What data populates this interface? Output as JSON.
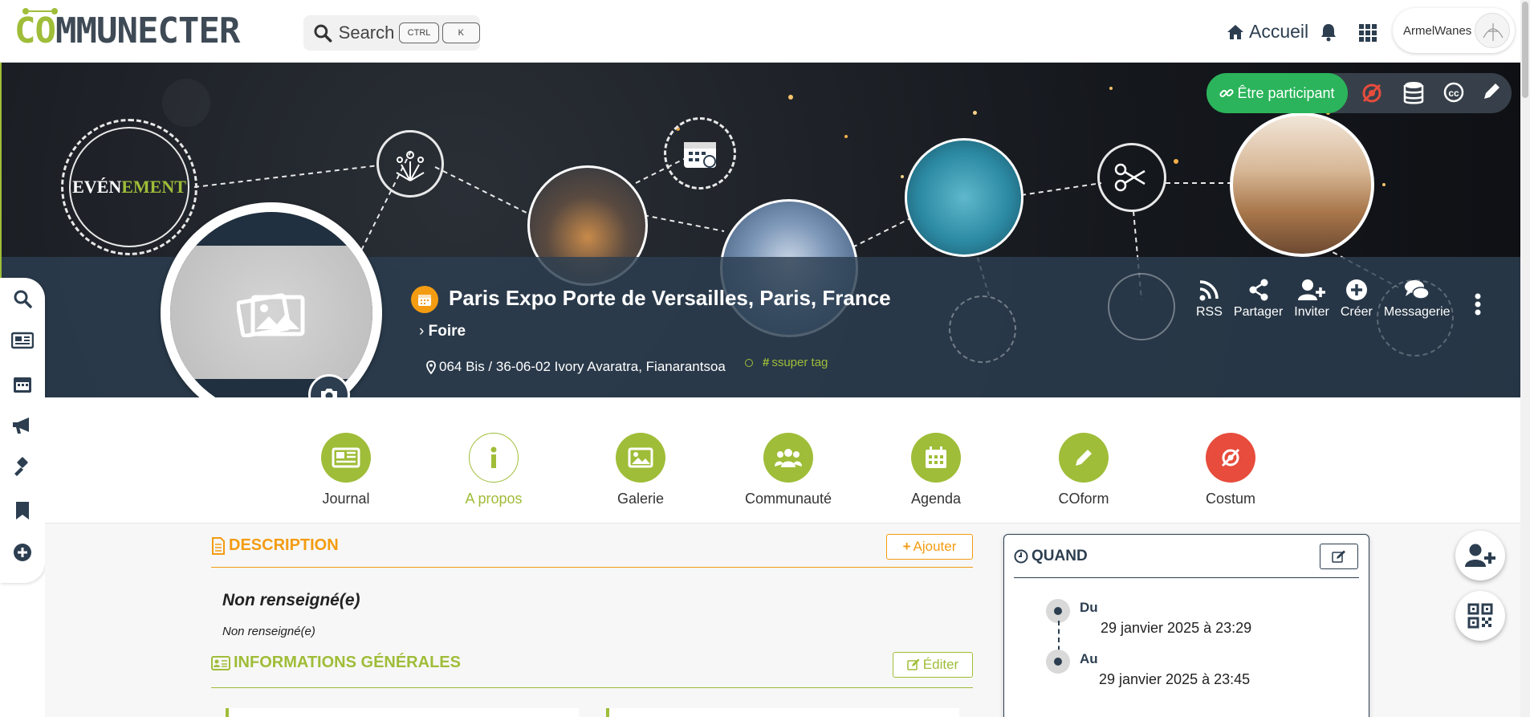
{
  "header": {
    "logo_text_co": "CO",
    "logo_text_rest": "MMUNECTER",
    "search_label": "Search",
    "kbd_ctrl": "CTRL",
    "kbd_k": "K",
    "home_label": "Accueil",
    "username": "ArmelWanes"
  },
  "banner": {
    "participate_label": "Être participant",
    "evenement_badge": {
      "part1": "EVÉN",
      "part2": "EMENT"
    },
    "event_title": "Paris Expo Porte de Versailles, Paris, France",
    "event_type": "Foire",
    "address": "064 Bis / 36-06-02 Ivory Avaratra, Fianarantsoa",
    "tag": "ssuper tag",
    "quick_actions": [
      {
        "label": "RSS",
        "icon": "rss-icon"
      },
      {
        "label": "Partager",
        "icon": "share-icon"
      },
      {
        "label": "Inviter",
        "icon": "invite-icon"
      },
      {
        "label": "Créer",
        "icon": "plus-circle-icon"
      },
      {
        "label": "Messagerie",
        "icon": "chat-icon"
      }
    ]
  },
  "tabs": [
    {
      "label": "Journal",
      "icon": "newspaper-icon"
    },
    {
      "label": "A propos",
      "icon": "info-icon"
    },
    {
      "label": "Galerie",
      "icon": "image-icon"
    },
    {
      "label": "Communauté",
      "icon": "users-icon"
    },
    {
      "label": "Agenda",
      "icon": "calendar-icon"
    },
    {
      "label": "COform",
      "icon": "pencil-icon"
    },
    {
      "label": "Costum",
      "icon": "costum-icon"
    }
  ],
  "description": {
    "title": "DESCRIPTION",
    "add_label": "Ajouter",
    "short": "Non renseigné(e)",
    "long": "Non renseigné(e)"
  },
  "general": {
    "title": "INFORMATIONS GÉNÉRALES",
    "edit_label": "Éditer"
  },
  "quand": {
    "title": "QUAND",
    "from_label": "Du",
    "from_date": "29 janvier 2025 à 23:29",
    "to_label": "Au",
    "to_date": "29 janvier 2025 à 23:45"
  },
  "colors": {
    "brand_green": "#9fbd38",
    "orange": "#f39c12",
    "dark": "#2c3e50",
    "participant_green": "#2bb45b"
  }
}
